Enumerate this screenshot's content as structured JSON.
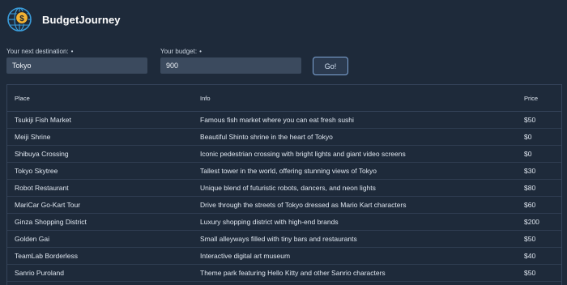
{
  "app": {
    "title": "BudgetJourney",
    "logo_icon": "globe-money-icon"
  },
  "form": {
    "destination_label": "Your next destination:",
    "destination_required": "•",
    "destination_value": "Tokyo",
    "budget_label": "Your budget:",
    "budget_required": "•",
    "budget_value": "900",
    "go_label": "Go!"
  },
  "table": {
    "headers": [
      "Place",
      "Info",
      "Price"
    ],
    "rows": [
      {
        "place": "Tsukiji Fish Market",
        "info": "Famous fish market where you can eat fresh sushi",
        "price": "$50"
      },
      {
        "place": "Meiji Shrine",
        "info": "Beautiful Shinto shrine in the heart of Tokyo",
        "price": "$0"
      },
      {
        "place": "Shibuya Crossing",
        "info": "Iconic pedestrian crossing with bright lights and giant video screens",
        "price": "$0"
      },
      {
        "place": "Tokyo Skytree",
        "info": "Tallest tower in the world, offering stunning views of Tokyo",
        "price": "$30"
      },
      {
        "place": "Robot Restaurant",
        "info": "Unique blend of futuristic robots, dancers, and neon lights",
        "price": "$80"
      },
      {
        "place": "MariCar Go-Kart Tour",
        "info": "Drive through the streets of Tokyo dressed as Mario Kart characters",
        "price": "$60"
      },
      {
        "place": "Ginza Shopping District",
        "info": "Luxury shopping district with high-end brands",
        "price": "$200"
      },
      {
        "place": "Golden Gai",
        "info": "Small alleyways filled with tiny bars and restaurants",
        "price": "$50"
      },
      {
        "place": "TeamLab Borderless",
        "info": "Interactive digital art museum",
        "price": "$40"
      },
      {
        "place": "Sanrio Puroland",
        "info": "Theme park featuring Hello Kitty and other Sanrio characters",
        "price": "$50"
      }
    ]
  },
  "colors": {
    "background": "#1e2a3a",
    "input_bg": "#3b4a5e",
    "button_border": "#7fa5d6",
    "logo_globe": "#3a9bd8",
    "logo_coin": "#f2b233"
  }
}
